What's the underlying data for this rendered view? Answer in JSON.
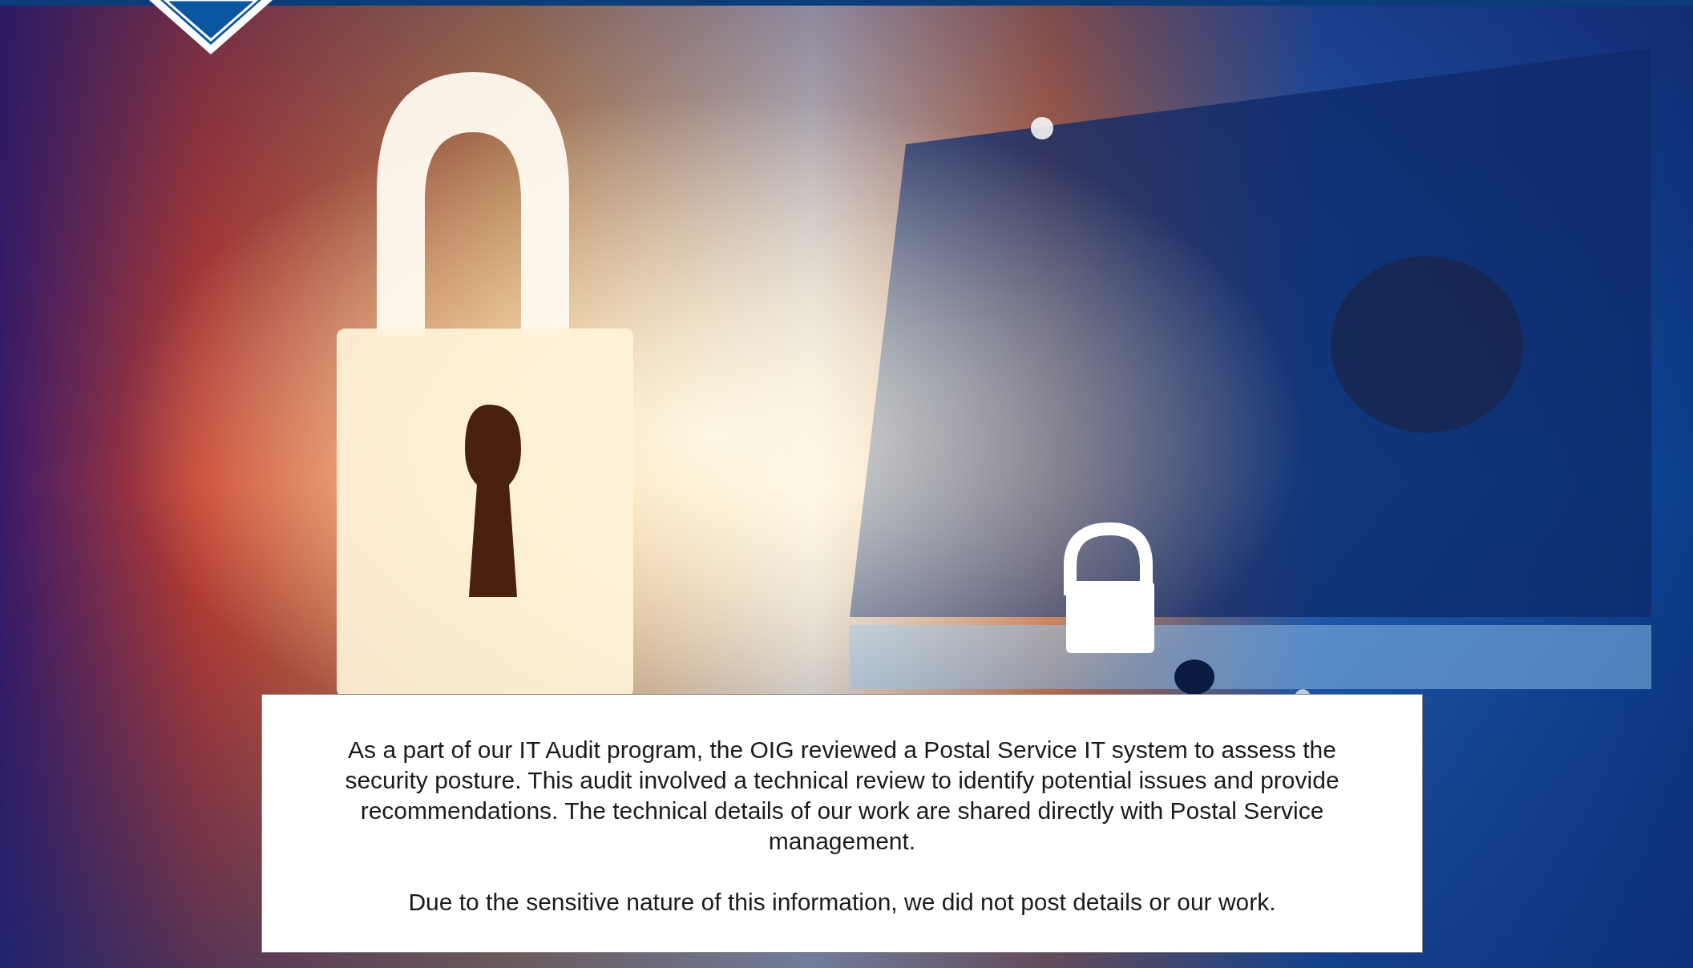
{
  "notice": {
    "paragraphs": [
      "As a part of our IT Audit program, the OIG reviewed a Postal Service IT system to assess the security posture. This audit involved a technical review to identify potential issues and provide recommendations. The technical details of our work are shared directly with Postal Service management.",
      "Due to the sensitive nature of this information, we did not post details or our work."
    ]
  }
}
